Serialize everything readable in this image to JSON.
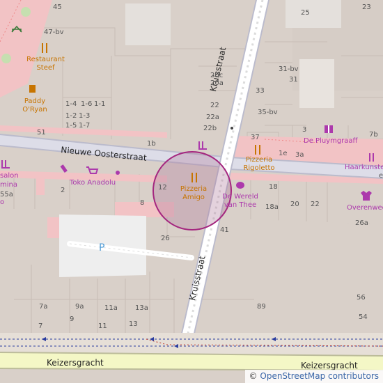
{
  "map": {
    "streets": {
      "nieuwe_oosterstraat": "Nieuwe Oosterstraat",
      "kruisstraat_north": "Kruisstraat",
      "kruisstraat_south": "Kruisstraat",
      "keizersgracht_west": "Keizersgracht",
      "keizersgracht_east": "Keizersgracht"
    },
    "pois": {
      "restaurant_steef": "Restaurant Steef",
      "paddy_oryan": "Paddy O'Ryan",
      "pizzeria_rigoletto": "Pizzeria Rigoletto",
      "pizzeria_amigo": "Pizzeria Amigo",
      "toko_anadolu": "Toko Anadolu",
      "de_wereld_van_thee": "De Wereld van Thee",
      "de_pluymgraaff": "De Pluymgraaff",
      "haarkunste": "Haarkunste",
      "overenwee": "Overenwee",
      "salon_partial": "salon",
      "mina_partial": "mina",
      "parking": "P"
    },
    "house_numbers": [
      "45",
      "47-bv",
      "25",
      "23",
      "20c",
      "20a",
      "31-bv",
      "31",
      "33",
      "22",
      "22a",
      "22b",
      "35-bv",
      "37",
      "3",
      "1-4",
      "1-6",
      "1-1",
      "1-2",
      "1-3",
      "1-5",
      "1-7",
      "51",
      "1b",
      "1e",
      "3a",
      "7b",
      "12",
      "18",
      "20",
      "22",
      "2",
      "8",
      "55a",
      "26",
      "41",
      "18a",
      "26a",
      "7a",
      "9a",
      "11a",
      "13a",
      "7",
      "9",
      "11",
      "13",
      "89",
      "56",
      "54"
    ],
    "edge_fragments": {
      "e_right": "e",
      "o_left": "o"
    },
    "attribution": {
      "prefix": "© ",
      "text": "OpenStreetMap contributors"
    },
    "colors": {
      "building": "#d9d0c9",
      "land": "#e2dcd4",
      "pedestrian": "#f2c3c5",
      "road": "#dddde8",
      "road_edge": "#bbbbcc",
      "kruisstraat": "#ffffff",
      "canal_road": "#f4f7c6",
      "circle_fill": "#b37d9f",
      "circle_stroke": "#a4267f",
      "poi_food": "#c77400",
      "poi_shop": "#ac39ac",
      "parking_label": "#4e9bd6"
    }
  }
}
